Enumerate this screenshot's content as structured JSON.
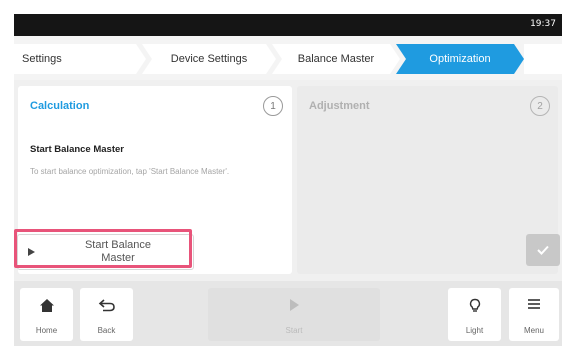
{
  "status": {
    "time": "19:37"
  },
  "breadcrumb": {
    "items": [
      {
        "label": "Settings"
      },
      {
        "label": "Device Settings"
      },
      {
        "label": "Balance Master"
      },
      {
        "label": "Optimization"
      }
    ]
  },
  "calculation": {
    "title": "Calculation",
    "step": "1",
    "heading": "Start Balance Master",
    "description": "To start balance optimization, tap 'Start Balance Master'.",
    "start_button": "Start Balance\nMaster"
  },
  "adjustment": {
    "title": "Adjustment",
    "step": "2"
  },
  "bottom": {
    "home": "Home",
    "back": "Back",
    "start": "Start",
    "light": "Light",
    "menu": "Menu"
  },
  "colors": {
    "accent": "#1f9be0",
    "highlight": "#e8547a",
    "statusbar": "#151515"
  }
}
